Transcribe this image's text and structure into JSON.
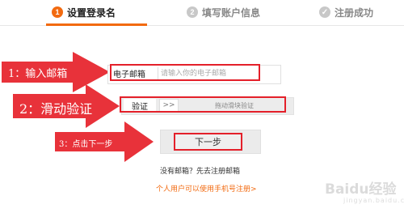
{
  "steps": [
    {
      "num": "1",
      "label": "设置登录名"
    },
    {
      "num": "2",
      "label": "填写账户信息"
    },
    {
      "num": "✓",
      "label": "注册成功"
    }
  ],
  "annotations": [
    {
      "text": "1：输入邮箱"
    },
    {
      "text": "2：滑动验证"
    },
    {
      "text": "3：点击下一步"
    }
  ],
  "form": {
    "email_label": "电子邮箱",
    "email_placeholder": "请输入你的电子邮箱",
    "verify_label": "验证",
    "slider_handle": ">>",
    "slider_hint": "拖动滑块验证",
    "next_button": "下一步",
    "no_email_text": "没有邮箱？先去注册邮箱",
    "phone_link": "个人用户可以使用手机号注册>"
  },
  "watermark": {
    "text": "Baidu经验",
    "sub": "jingyan.baidu.com"
  },
  "colors": {
    "accent": "#f26a10",
    "highlight_red": "#e4202a",
    "arrow_red": "#e8323a"
  }
}
